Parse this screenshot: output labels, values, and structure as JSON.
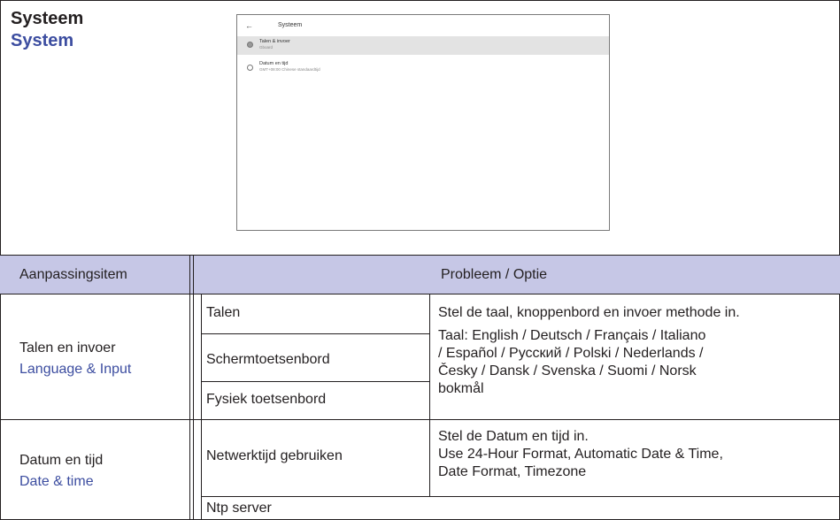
{
  "section": {
    "title_nl": "Systeem",
    "title_en": "System"
  },
  "screenshot": {
    "back_icon": "arrow-left-icon",
    "title": "Systeem",
    "items": [
      {
        "icon": "globe-icon",
        "label": "Talen & invoer",
        "sublabel": "Gboard"
      },
      {
        "icon": "clock-icon",
        "label": "Datum en tijd",
        "sublabel": "GMT+08:00 Chinese standaardtijd"
      }
    ]
  },
  "table": {
    "header_item": "Aanpassingsitem",
    "header_option": "Probleem / Optie",
    "header_color": "#c6c7e6",
    "groups": [
      {
        "name_nl": "Talen en invoer",
        "name_en": "Language & Input",
        "subitems": [
          "Talen",
          "Schermtoetsenbord",
          "Fysiek toetsenbord"
        ],
        "description": [
          "Stel de taal, knoppenbord en invoer methode in.",
          "Taal: English / Deutsch / Français / Italiano",
          "/ Español / Русский / Polski / Nederlands /",
          "Česky / Dansk / Svenska / Suomi / Norsk",
          "bokmål"
        ]
      },
      {
        "name_nl": "Datum en tijd",
        "name_en": "Date & time",
        "subitems": [
          "Netwerktijd gebruiken",
          "Ntp server"
        ],
        "description": [
          "Stel de Datum en tijd in.",
          "Use 24-Hour Format, Automatic Date & Time,",
          "Date Format, Timezone"
        ]
      }
    ]
  }
}
